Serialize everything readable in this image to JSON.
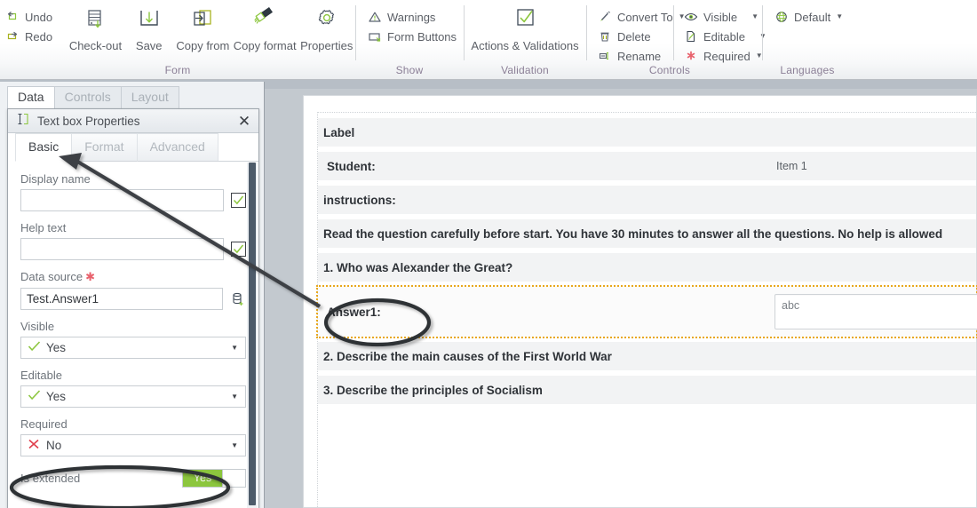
{
  "ribbon": {
    "groups": [
      {
        "label": "Form",
        "small_commands": [
          {
            "label": "Undo",
            "icon": "undo-icon"
          },
          {
            "label": "Redo",
            "icon": "redo-icon"
          }
        ],
        "big_commands": [
          {
            "label": "Check-out",
            "icon": "check-out-icon"
          },
          {
            "label": "Save",
            "icon": "save-icon"
          },
          {
            "label": "Copy from",
            "icon": "copy-from-icon"
          },
          {
            "label": "Copy format",
            "icon": "copy-format-icon"
          },
          {
            "label": "Properties",
            "icon": "properties-gear-icon"
          }
        ]
      },
      {
        "label": "Show",
        "small_commands": [
          {
            "label": "Warnings",
            "icon": "warning-triangle-icon"
          },
          {
            "label": "Form Buttons",
            "icon": "form-buttons-icon"
          }
        ],
        "big_commands": []
      },
      {
        "label": "Validation",
        "small_commands": [],
        "big_commands": [
          {
            "label": "Actions & Validations",
            "icon": "checkmark-box-icon"
          }
        ]
      },
      {
        "label": "Controls",
        "small_commands": [
          {
            "label": "Convert To",
            "icon": "convert-to-icon",
            "caret": true
          },
          {
            "label": "Delete",
            "icon": "trash-icon"
          },
          {
            "label": "Rename",
            "icon": "rename-icon"
          }
        ],
        "big_commands": []
      },
      {
        "label": "Controls",
        "hide_label": true,
        "small_commands": [
          {
            "label": "Visible",
            "icon": "eye-icon",
            "caret": true,
            "caret_spaced": true
          },
          {
            "label": "Editable",
            "icon": "editable-page-icon",
            "caret": true,
            "caret_spaced": true
          },
          {
            "label": "Required",
            "icon": "required-asterisk-icon",
            "caret": true
          }
        ],
        "big_commands": []
      },
      {
        "label": "Languages",
        "small_commands": [
          {
            "label": "Default",
            "icon": "globe-icon",
            "caret": true
          }
        ],
        "big_commands": []
      }
    ]
  },
  "left_panel": {
    "tabs": [
      {
        "label": "Data",
        "active": true
      },
      {
        "label": "Controls",
        "active": false
      },
      {
        "label": "Layout",
        "active": false
      }
    ],
    "properties_window": {
      "title": "Text box Properties",
      "title_icon": "text-box-icon",
      "close_icon": "close-icon",
      "subtabs": [
        {
          "label": "Basic",
          "active": true
        },
        {
          "label": "Format",
          "active": false
        },
        {
          "label": "Advanced",
          "active": false
        }
      ],
      "fields": {
        "display_name": {
          "label": "Display name",
          "value": "",
          "placeholder": "",
          "checkbox_checked": true
        },
        "help_text": {
          "label": "Help text",
          "value": "",
          "placeholder": "",
          "checkbox_checked": true
        },
        "data_source": {
          "label": "Data source",
          "required_marker": "✱",
          "value": "Test.Answer1",
          "button_icon": "database-add-icon"
        },
        "visible": {
          "label": "Visible",
          "value": "Yes",
          "state_icon": "check-green-icon"
        },
        "editable": {
          "label": "Editable",
          "value": "Yes",
          "state_icon": "check-green-icon"
        },
        "required": {
          "label": "Required",
          "value": "No",
          "state_icon": "cross-red-icon"
        },
        "is_extended": {
          "label": "Is extended",
          "value": "Yes"
        }
      }
    }
  },
  "form_preview": {
    "rows": [
      {
        "id": "label-row",
        "text": "Label",
        "value": "",
        "type": "label"
      },
      {
        "id": "student-row",
        "text": "Student:",
        "value": "Item 1",
        "type": "field"
      },
      {
        "id": "instructions-row",
        "text": "instructions:",
        "value": "",
        "type": "label"
      },
      {
        "id": "instructions-text",
        "text": "Read the question carefully before start. You have 30 minutes to answer all the questions. No help is allowed",
        "value": "",
        "type": "label"
      },
      {
        "id": "question-1",
        "text": "1. Who was Alexander the Great?",
        "value": "",
        "type": "label"
      },
      {
        "id": "answer-1",
        "text": "Answer1:",
        "value": "abc",
        "type": "selected-field"
      },
      {
        "id": "question-2",
        "text": "2. Describe the main causes of the First World War",
        "value": "",
        "type": "label"
      },
      {
        "id": "question-3",
        "text": "3. Describe the principles of Socialism",
        "value": "",
        "type": "label"
      }
    ]
  },
  "annotations": {
    "arrow": {
      "name": "pointer-arrow",
      "from": "answer1-row",
      "to": "basic-tab"
    },
    "ellipse_answer": {
      "name": "highlight-ellipse-answer1"
    },
    "ellipse_extended": {
      "name": "highlight-ellipse-is-extended"
    }
  },
  "colors": {
    "accent_green": "#8cc63e",
    "selection_orange": "#e8a81e",
    "required_red": "#e8626d",
    "group_label": "#8b7f96",
    "scrollbar": "#4d5b6a"
  }
}
